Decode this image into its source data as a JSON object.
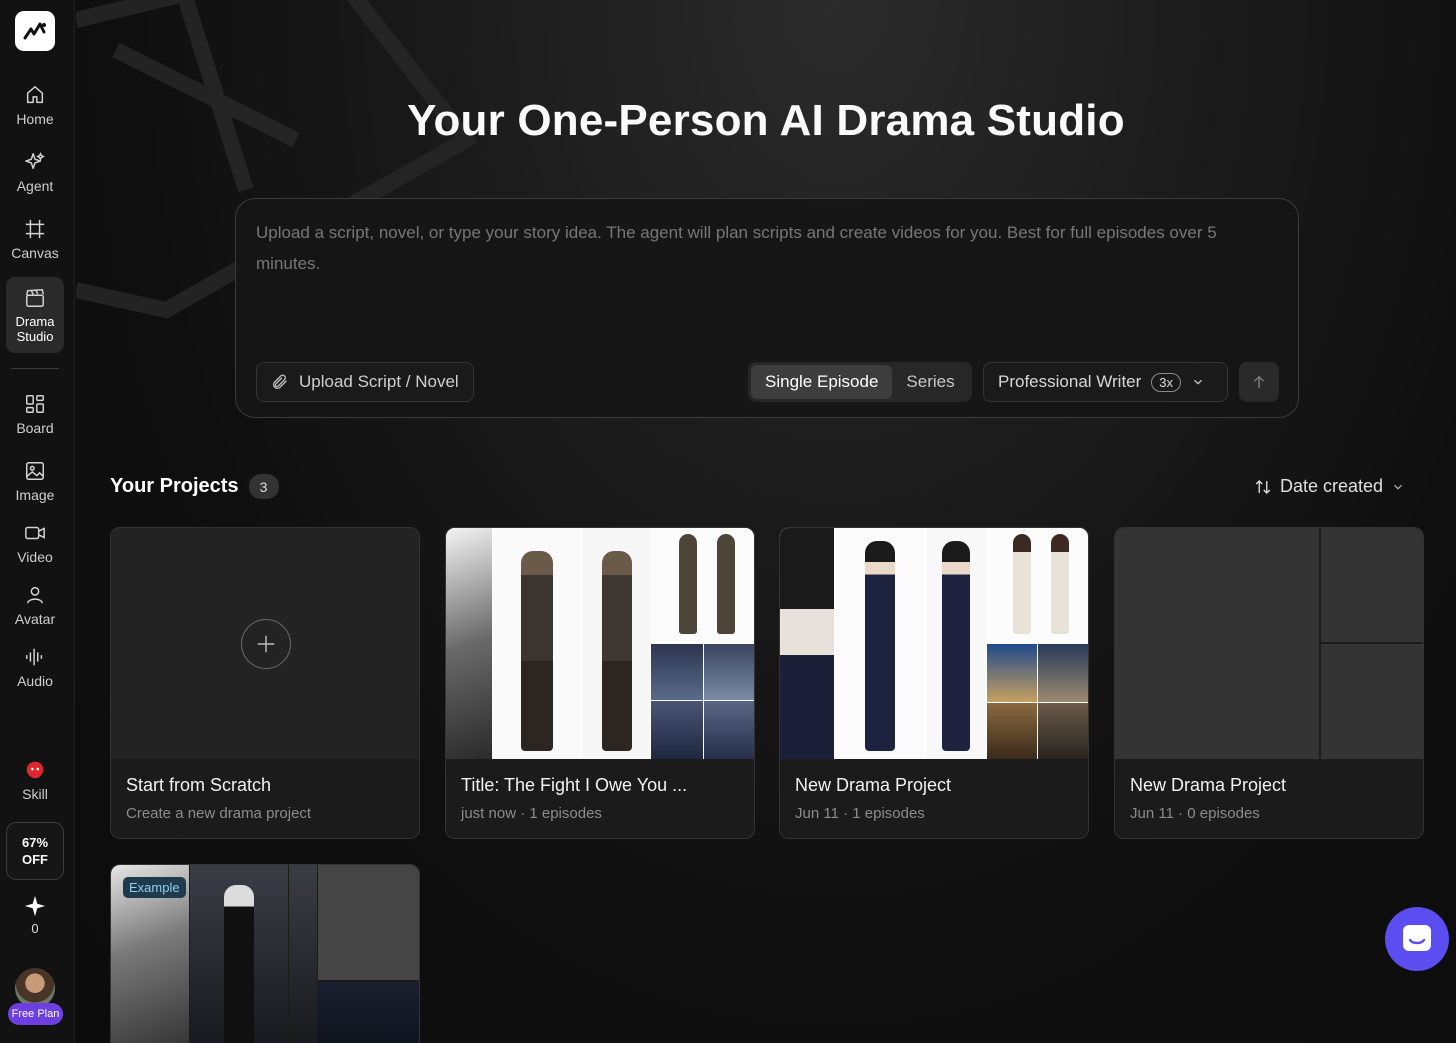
{
  "sidebar": {
    "items": [
      {
        "label": "Home",
        "icon": "home-icon"
      },
      {
        "label": "Agent",
        "icon": "sparkle-icon"
      },
      {
        "label": "Canvas",
        "icon": "frame-icon"
      },
      {
        "label": "Drama Studio",
        "icon": "clapperboard-icon"
      },
      {
        "label": "Board",
        "icon": "grid-icon"
      },
      {
        "label": "Image",
        "icon": "image-icon"
      },
      {
        "label": "Video",
        "icon": "video-icon"
      },
      {
        "label": "Avatar",
        "icon": "person-icon"
      },
      {
        "label": "Audio",
        "icon": "waveform-icon"
      },
      {
        "label": "Skill",
        "icon": "skill-icon"
      }
    ],
    "offer": {
      "line1": "67%",
      "line2": "OFF"
    },
    "credits": "0",
    "plan": "Free Plan"
  },
  "hero": {
    "title": "Your One-Person AI Drama Studio"
  },
  "prompt": {
    "placeholder": "Upload a script, novel, or type your story idea. The agent will plan scripts and create videos for you. Best for full episodes over 5 minutes.",
    "upload_label": "Upload Script / Novel",
    "modes": [
      "Single Episode",
      "Series"
    ],
    "selected_mode": "Single Episode",
    "writer_label": "Professional Writer",
    "writer_multiplier": "3x"
  },
  "projects": {
    "title": "Your Projects",
    "count": "3",
    "sort_label": "Date created",
    "cards": [
      {
        "title": "Start from Scratch",
        "subtitle": "Create a new drama project"
      },
      {
        "title": "Title: The Fight I Owe You ...",
        "subtitle": "just now · 1 episodes"
      },
      {
        "title": "New Drama Project",
        "subtitle": "Jun 11 · 1 episodes"
      },
      {
        "title": "New Drama Project",
        "subtitle": "Jun 11 · 0 episodes"
      }
    ],
    "example_badge": "Example"
  },
  "colors": {
    "accent_purple": "#6d3fe0",
    "chat_button": "#5a4ef0",
    "example_badge_text": "#8fd0ef"
  }
}
